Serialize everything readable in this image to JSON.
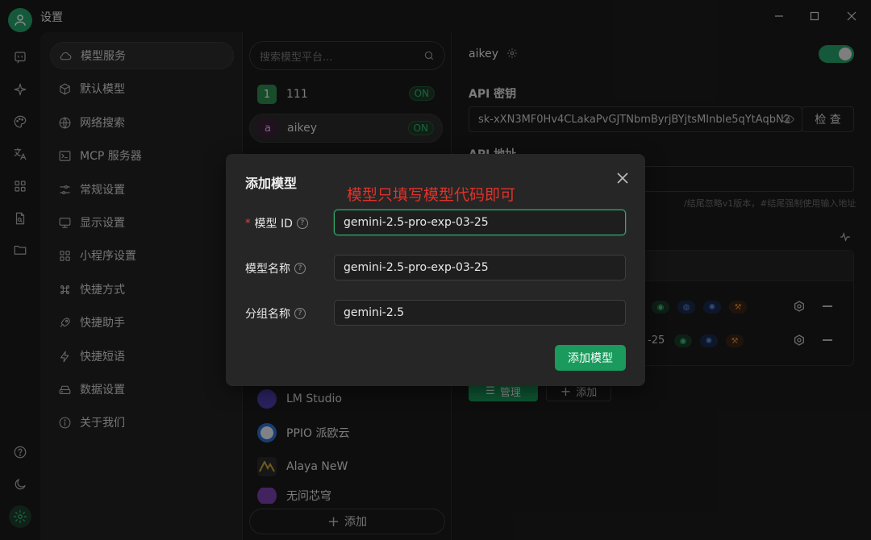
{
  "window": {
    "title": "设置"
  },
  "nav": {
    "items": [
      {
        "label": "模型服务",
        "icon": "cloud-icon",
        "active": true
      },
      {
        "label": "默认模型",
        "icon": "cube-icon"
      },
      {
        "label": "网络搜索",
        "icon": "globe-icon"
      },
      {
        "label": "MCP 服务器",
        "icon": "terminal-icon"
      },
      {
        "label": "常规设置",
        "icon": "sliders-icon"
      },
      {
        "label": "显示设置",
        "icon": "monitor-icon"
      },
      {
        "label": "小程序设置",
        "icon": "grid-icon"
      },
      {
        "label": "快捷方式",
        "icon": "command-icon"
      },
      {
        "label": "快捷助手",
        "icon": "rocket-icon"
      },
      {
        "label": "快捷短语",
        "icon": "zap-icon"
      },
      {
        "label": "数据设置",
        "icon": "drive-icon"
      },
      {
        "label": "关于我们",
        "icon": "info-icon"
      }
    ]
  },
  "providers": {
    "search_placeholder": "搜索模型平台...",
    "items": [
      {
        "name": "111",
        "logo_text": "1",
        "logo_color": "#2e8b4e",
        "badge": "ON"
      },
      {
        "name": "aikey",
        "logo_text": "a",
        "logo_color": "#3b1f3a",
        "badge": "ON",
        "active": true
      },
      {
        "name": "LM Studio",
        "logo_text": "",
        "logo_color": "#4b3fb0"
      },
      {
        "name": "PPIO 派欧云",
        "logo_text": "",
        "logo_color": "#2d6fcf"
      },
      {
        "name": "Alaya NeW",
        "logo_text": "",
        "logo_color": "#c8a23a"
      },
      {
        "name": "无问芯穹",
        "logo_text": "",
        "logo_color": "#7a3fb0"
      }
    ],
    "add_label": "添加"
  },
  "detail": {
    "provider_name": "aikey",
    "api_key_label": "API 密钥",
    "api_key_value": "sk-xXN3MF0Hv4CLakaPvGJTNbmByrjBYjtsMInble5qYtAqbN2",
    "check_label": "检 查",
    "api_url_label": "API 地址",
    "hint": "/结尾忽略v1版本，#结尾强制使用输入地址",
    "row_suffix": "-25",
    "manage_label": "管理",
    "add_label": "添加"
  },
  "modal": {
    "title": "添加模型",
    "annotation": "模型只填写模型代码即可",
    "fields": {
      "model_id": {
        "label": "模型 ID",
        "value": "gemini-2.5-pro-exp-03-25"
      },
      "model_name": {
        "label": "模型名称",
        "value": "gemini-2.5-pro-exp-03-25"
      },
      "group_name": {
        "label": "分组名称",
        "value": "gemini-2.5"
      }
    },
    "submit_label": "添加模型"
  },
  "colors": {
    "accent": "#25a36a",
    "danger": "#e0322a"
  }
}
